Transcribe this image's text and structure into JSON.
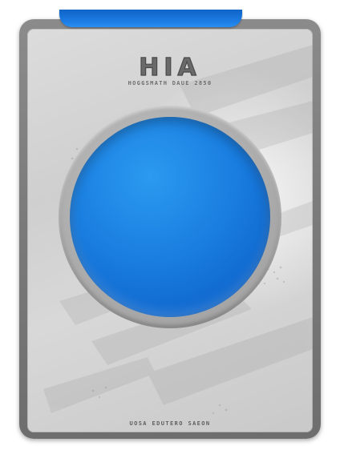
{
  "card": {
    "brand_logo_text": "HIA",
    "brand_subline_text": "HOGGSMATH DAUE 2850",
    "footer_text": "UOSA EDUTERO SAEON"
  },
  "colors": {
    "accent_blue": "#1d7ee6",
    "frame_gray": "#7a7a7a",
    "panel_silver": "#d6d6d6"
  },
  "icons": {
    "orb": "blue-orb-icon",
    "top_tab": "blue-tab-accent"
  }
}
